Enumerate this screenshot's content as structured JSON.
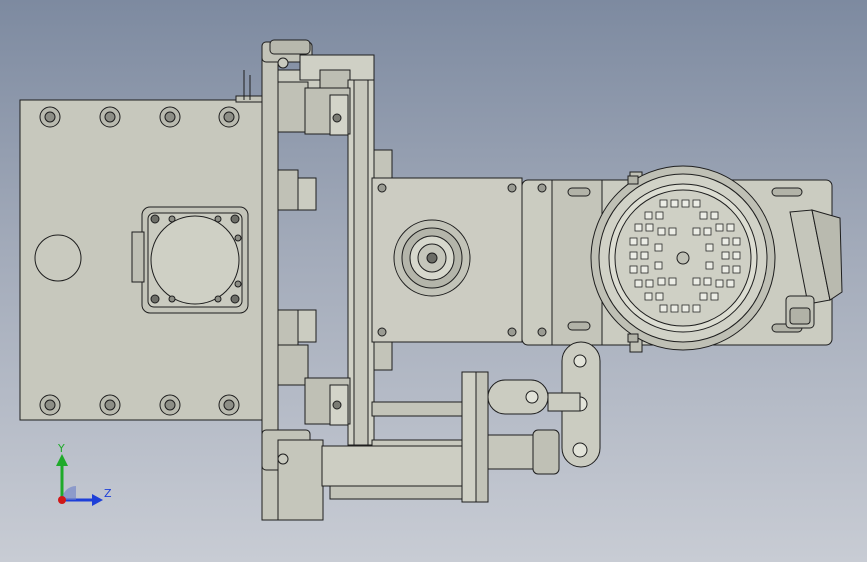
{
  "viewport": {
    "background_top": "#7d8aa0",
    "background_bottom": "#c8ccd4",
    "part_fill": "#c9cabf",
    "part_shade": "#b2b3a8",
    "edge_color": "#1e1e1e"
  },
  "triad": {
    "y_label": "Y",
    "z_label": "Z",
    "y_color": "#1faa2a",
    "z_color": "#1e3fd8",
    "x_color": "#d01818"
  }
}
